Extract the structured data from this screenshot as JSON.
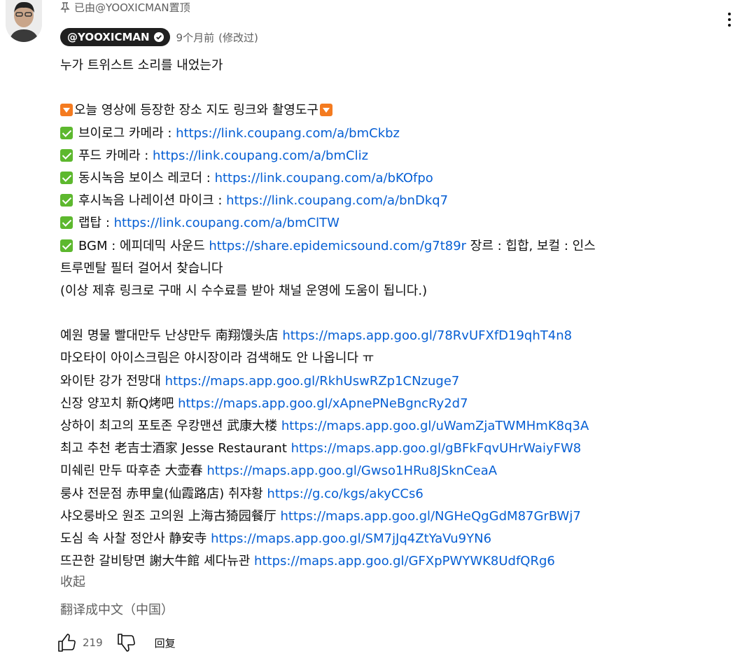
{
  "pinned_note": "已由@YOOXICMAN置顶",
  "author": {
    "handle": "@YOOXICMAN",
    "time": "9个月前",
    "edited": "(修改过)"
  },
  "comment_lines": [
    {
      "kind": "text",
      "text": "누가 트위스트 소리를 내었는가"
    },
    {
      "kind": "blank"
    },
    {
      "kind": "header",
      "text": "오늘 영상에 등장한 장소 지도 링크와 촬영도구"
    },
    {
      "kind": "check",
      "text": "브이로그 카메라 : ",
      "link": "https://link.coupang.com/a/bmCkbz",
      "after": ""
    },
    {
      "kind": "check",
      "text": "푸드 카메라 : ",
      "link": "https://link.coupang.com/a/bmCliz",
      "after": ""
    },
    {
      "kind": "check",
      "text": "동시녹음 보이스 레코더 : ",
      "link": "https://link.coupang.com/a/bKOfpo",
      "after": ""
    },
    {
      "kind": "check",
      "text": "후시녹음 나레이션 마이크 : ",
      "link": "https://link.coupang.com/a/bnDkq7",
      "after": ""
    },
    {
      "kind": "check",
      "text": "랩탑 : ",
      "link": "https://link.coupang.com/a/bmClTW",
      "after": ""
    },
    {
      "kind": "check",
      "text": "BGM : 에피데믹 사운드 ",
      "link": "https://share.epidemicsound.com/g7t89r",
      "after": " 장르 : 힙합, 보컬 : 인스"
    },
    {
      "kind": "text",
      "text": "트루멘탈 필터 걸어서 찾습니다"
    },
    {
      "kind": "text",
      "text": "(이상 제휴 링크로 구매 시 수수료를 받아 채널 운영에 도움이 됩니다.)"
    },
    {
      "kind": "blank"
    },
    {
      "kind": "link",
      "text": "예원 명물 빨대만두 난샹만두 南翔馒头店 ",
      "link": "https://maps.app.goo.gl/78RvUFXfD19qhT4n8",
      "after": ""
    },
    {
      "kind": "text",
      "text": "마오타이 아이스크림은 야시장이라 검색해도 안 나옵니다 ㅠ"
    },
    {
      "kind": "link",
      "text": "와이탄 강가 전망대 ",
      "link": "https://maps.app.goo.gl/RkhUswRZp1CNzuge7",
      "after": ""
    },
    {
      "kind": "link",
      "text": "신장 양꼬치 新Q烤吧 ",
      "link": "https://maps.app.goo.gl/xApnePNeBgncRy2d7",
      "after": ""
    },
    {
      "kind": "link",
      "text": "상하이 최고의 포토존 우캉맨션 武康大楼 ",
      "link": "https://maps.app.goo.gl/uWamZjaTWMHmK8q3A",
      "after": ""
    },
    {
      "kind": "link",
      "text": "최고 추천 老吉士酒家 Jesse Restaurant ",
      "link": "https://maps.app.goo.gl/gBFkFqvUHrWaiyFW8",
      "after": ""
    },
    {
      "kind": "link",
      "text": "미쉐린 만두 따후춘 大壶春 ",
      "link": "https://maps.app.goo.gl/Gwso1HRu8JSknCeaA",
      "after": ""
    },
    {
      "kind": "link",
      "text": "룽샤 전문점 赤甲皇(仙霞路店) 취쟈황 ",
      "link": "https://g.co/kgs/akyCCs6",
      "after": ""
    },
    {
      "kind": "link",
      "text": "샤오룽바오 원조 고의원 上海古猗园餐厅 ",
      "link": "https://maps.app.goo.gl/NGHeQgGdM87GrBWj7",
      "after": ""
    },
    {
      "kind": "link",
      "text": "도심 속 사찰 정안사 静安寺 ",
      "link": "https://maps.app.goo.gl/SM7jJq4ZtYaVu9YN6",
      "after": ""
    },
    {
      "kind": "link",
      "text": "뜨끈한 갈비탕면 謝大牛館 셰다뉴관 ",
      "link": "https://maps.app.goo.gl/GFXpPWYWK8UdfQRg6",
      "after": ""
    }
  ],
  "collapse_label": "收起",
  "translate_label": "翻译成中文（中国）",
  "like_count": "219",
  "reply_label": "回复",
  "colors": {
    "link": "#065fd4",
    "secondary_text": "#606060",
    "chip_bg": "#1f1f1f"
  },
  "icons": {
    "pin": "pin-icon",
    "verified": "verified-check-icon",
    "more": "more-vert-icon",
    "like": "thumb-up-icon",
    "dislike": "thumb-down-icon",
    "header_emoji": "orange-down-triangle-emoji",
    "check_emoji": "check-mark-button-emoji"
  }
}
